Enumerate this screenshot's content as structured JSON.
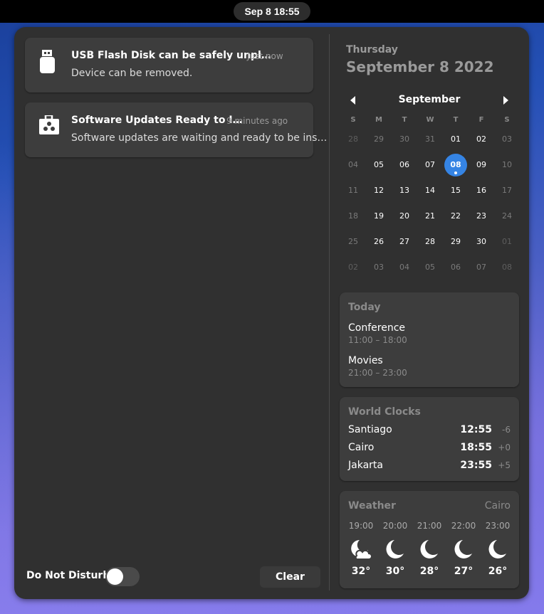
{
  "topbar": {
    "clock": "Sep 8  18:55"
  },
  "notifications": [
    {
      "icon": "usb-drive-icon",
      "title": "USB Flash Disk can be safely unpl…",
      "time": "Just now",
      "body": "Device can be removed."
    },
    {
      "icon": "software-update-icon",
      "title": "Software Updates Ready to I…",
      "time": "9 minutes ago",
      "body": "Software updates are waiting and ready to be ins…"
    }
  ],
  "footer": {
    "dnd_label": "Do Not Disturb",
    "dnd_on": false,
    "clear_label": "Clear"
  },
  "date": {
    "weekday": "Thursday",
    "full": "September 8 2022"
  },
  "calendar": {
    "month": "September",
    "weekdays": [
      "S",
      "M",
      "T",
      "W",
      "T",
      "F",
      "S"
    ],
    "today": "08",
    "weeks": [
      [
        [
          "28",
          "other"
        ],
        [
          "29",
          "dim"
        ],
        [
          "30",
          "dim"
        ],
        [
          "31",
          "dim"
        ],
        [
          "01",
          ""
        ],
        [
          "02",
          ""
        ],
        [
          "03",
          "dim"
        ]
      ],
      [
        [
          "04",
          "dim"
        ],
        [
          "05",
          ""
        ],
        [
          "06",
          ""
        ],
        [
          "07",
          ""
        ],
        [
          "08",
          "today"
        ],
        [
          "09",
          ""
        ],
        [
          "10",
          "dim"
        ]
      ],
      [
        [
          "11",
          "dim"
        ],
        [
          "12",
          ""
        ],
        [
          "13",
          ""
        ],
        [
          "14",
          ""
        ],
        [
          "15",
          ""
        ],
        [
          "16",
          ""
        ],
        [
          "17",
          "dim"
        ]
      ],
      [
        [
          "18",
          "dim"
        ],
        [
          "19",
          ""
        ],
        [
          "20",
          ""
        ],
        [
          "21",
          ""
        ],
        [
          "22",
          ""
        ],
        [
          "23",
          ""
        ],
        [
          "24",
          "dim"
        ]
      ],
      [
        [
          "25",
          "dim"
        ],
        [
          "26",
          ""
        ],
        [
          "27",
          ""
        ],
        [
          "28",
          ""
        ],
        [
          "29",
          ""
        ],
        [
          "30",
          ""
        ],
        [
          "01",
          "other"
        ]
      ],
      [
        [
          "02",
          "other"
        ],
        [
          "03",
          "dim"
        ],
        [
          "04",
          "dim"
        ],
        [
          "05",
          "dim"
        ],
        [
          "06",
          "dim"
        ],
        [
          "07",
          "dim"
        ],
        [
          "08",
          "other"
        ]
      ]
    ]
  },
  "events": {
    "title": "Today",
    "items": [
      {
        "name": "Conference",
        "time": "11:00 – 18:00"
      },
      {
        "name": "Movies",
        "time": "21:00 – 23:00"
      }
    ]
  },
  "world_clocks": {
    "title": "World Clocks",
    "items": [
      {
        "city": "Santiago",
        "time": "12:55",
        "offset": "-6"
      },
      {
        "city": "Cairo",
        "time": "18:55",
        "offset": "+0"
      },
      {
        "city": "Jakarta",
        "time": "23:55",
        "offset": "+5"
      }
    ]
  },
  "weather": {
    "title": "Weather",
    "location": "Cairo",
    "forecast": [
      {
        "hour": "19:00",
        "icon": "night-partly-cloudy-icon",
        "temp": "32°"
      },
      {
        "hour": "20:00",
        "icon": "night-clear-icon",
        "temp": "30°"
      },
      {
        "hour": "21:00",
        "icon": "night-clear-icon",
        "temp": "28°"
      },
      {
        "hour": "22:00",
        "icon": "night-clear-icon",
        "temp": "27°"
      },
      {
        "hour": "23:00",
        "icon": "night-clear-icon",
        "temp": "26°"
      }
    ]
  },
  "colors": {
    "accent": "#3584e4",
    "panel": "#303030",
    "card": "#3d3d3d"
  }
}
